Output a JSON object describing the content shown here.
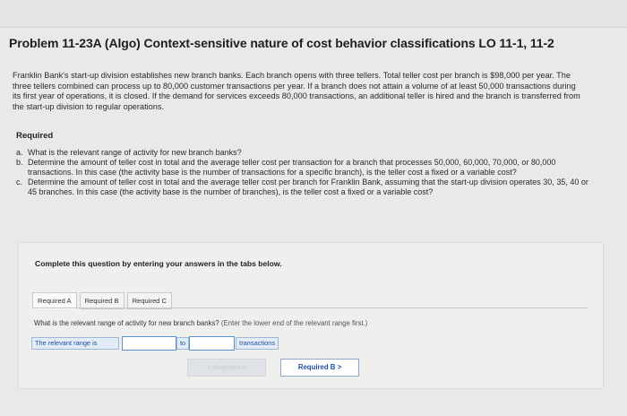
{
  "problem": {
    "title": "Problem 11-23A (Algo) Context-sensitive nature of cost behavior classifications LO 11-1, 11-2",
    "paragraph": "Franklin Bank's start-up division establishes new branch banks. Each branch opens with three tellers. Total teller cost per branch is $98,000 per year. The three tellers combined can process up to 80,000 customer transactions per year. If a branch does not attain a volume of at least 50,000 transactions during its first year of operations, it is closed. If the demand for services exceeds 80,000 transactions, an additional teller is hired and the branch is transferred from the start-up division to regular operations.",
    "required_heading": "Required",
    "requirements": [
      {
        "letter": "a.",
        "text": "What is the relevant range of activity for new branch banks?"
      },
      {
        "letter": "b.",
        "text": "Determine the amount of teller cost in total and the average teller cost per transaction for a branch that processes 50,000, 60,000, 70,000, or 80,000 transactions. In this case (the activity base is the number of transactions for a specific branch), is the teller cost a fixed or a variable cost?"
      },
      {
        "letter": "c.",
        "text": "Determine the amount of teller cost in total and the average teller cost per branch for Franklin Bank, assuming that the start-up division operates 30, 35, 40 or 45 branches. In this case (the activity base is the number of branches), is the teller cost a fixed or a variable cost?"
      }
    ]
  },
  "panel": {
    "instruction": "Complete this question by entering your answers in the tabs below.",
    "tabs": [
      {
        "label": "Required A"
      },
      {
        "label": "Required B"
      },
      {
        "label": "Required C"
      }
    ],
    "question": "What is the relevant range of activity for new branch banks?",
    "question_hint": "(Enter the lower end of the relevant range first.)",
    "answer": {
      "label": "The relevant range is",
      "lower_value": "",
      "to_label": "to",
      "upper_value": "",
      "unit_label": "transactions"
    },
    "nav": {
      "prev_label": "< Required A",
      "next_label": "Required B  >"
    }
  }
}
